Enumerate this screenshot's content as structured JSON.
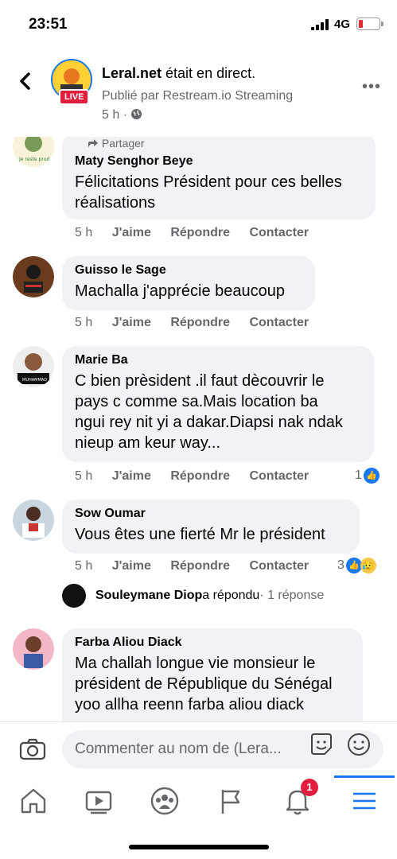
{
  "status": {
    "time": "23:51",
    "network": "4G"
  },
  "header": {
    "page_name": "Leral.net",
    "title_suffix": " était en direct.",
    "live_badge": "LIVE",
    "published_by": "Publié par Restream.io Streaming",
    "time": "5 h ·"
  },
  "partial_top": {
    "share_label": "Partager"
  },
  "comments": [
    {
      "name": "Maty Senghor Beye",
      "lines": [
        "Félicitations Président pour ces belles",
        "réalisations"
      ],
      "time": "5 h",
      "like": "J'aime",
      "reply": "Répondre",
      "contact": "Contacter"
    },
    {
      "name": "Guisso le Sage",
      "lines": [
        "Machalla j'apprécie beaucoup"
      ],
      "time": "5 h",
      "like": "J'aime",
      "reply": "Répondre",
      "contact": "Contacter"
    },
    {
      "name": "Marie Ba",
      "lines": [
        "C bien prèsident .il faut dècouvrir le",
        "pays c comme sa.Mais location ba",
        "ngui rey nit yi a dakar.Diapsi nak ndak",
        "nieup am keur way..."
      ],
      "time": "5 h",
      "like": "J'aime",
      "reply": "Répondre",
      "contact": "Contacter",
      "reaction_count": "1"
    },
    {
      "name": "Sow Oumar",
      "lines": [
        "Vous êtes une fierté Mr le président"
      ],
      "time": "5 h",
      "like": "J'aime",
      "reply": "Répondre",
      "contact": "Contacter",
      "reaction_count": "3"
    },
    {
      "name": "Farba Aliou Diack",
      "lines": [
        "Ma challah longue vie  monsieur le",
        "président de République du Sénégal",
        "yoo allha reenn  farba aliou diack"
      ]
    }
  ],
  "reply_summary": {
    "name": "Souleymane Diop",
    "action": " a répondu",
    "count": " · 1 réponse"
  },
  "composer": {
    "placeholder": "Commenter au nom de (Lera..."
  },
  "tabbar": {
    "notifications_badge": "1"
  },
  "colors": {
    "accent": "#1877f2",
    "live": "#e41e3f",
    "bubble": "#f0f2f5"
  }
}
